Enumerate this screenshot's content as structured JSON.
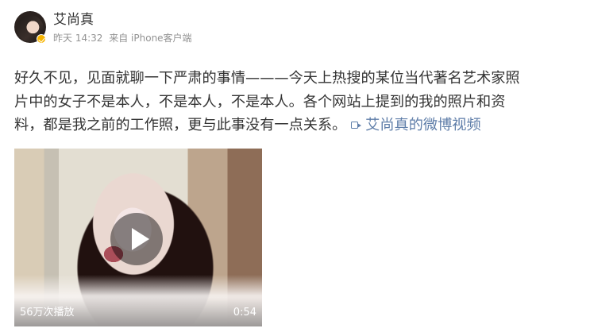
{
  "post": {
    "username": "艾尚真",
    "time": "昨天 14:32",
    "source": "来自 iPhone客户端",
    "text_lines": [
      "好久不见，见面就聊一下严肃的事情———今天上热搜的某位当代著名艺术家照",
      "片中的女子不是本人，不是本人，不是本人。各个网站上提到的我的照片和资",
      "料，都是我之前的工作照，更与此事没有一点关系。"
    ],
    "video_link_label": "艾尚真的微博视频",
    "video": {
      "views": "56万次播放",
      "duration": "0:54"
    }
  },
  "icons": {
    "avatar": "avatar-image",
    "verified": "verified-badge-icon",
    "video_link": "video-link-icon",
    "play": "play-icon"
  },
  "colors": {
    "link": "#5f7ea9",
    "meta": "#939393",
    "text": "#333333"
  }
}
